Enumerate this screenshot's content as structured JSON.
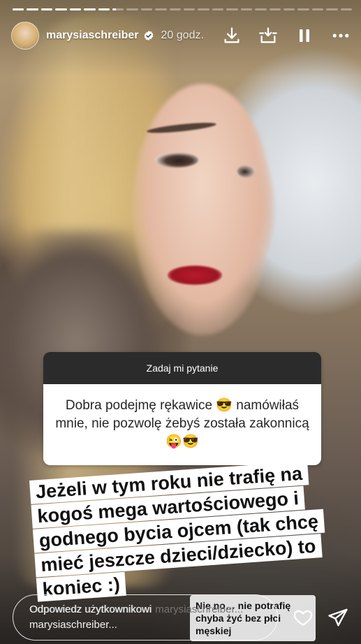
{
  "story": {
    "progress": {
      "segments": [
        1,
        1,
        1,
        1,
        1,
        1,
        1,
        0.3,
        0,
        0,
        0,
        0,
        0,
        0,
        0,
        0,
        0,
        0,
        0,
        0,
        0,
        0,
        0,
        0
      ]
    },
    "header": {
      "username": "marysiaschreiber",
      "time": "20 godz.",
      "icons": [
        "download-icon",
        "save-icon",
        "pause-icon",
        "more-icon"
      ]
    },
    "question_sticker": {
      "title": "Zadaj mi pytanie",
      "question": "Dobra podejmę rękawice 😎 namówiłaś mnie, nie pozwolę żebyś została zakonnicą 😜😎"
    },
    "answer_lines": [
      "Jeżeli w tym roku nie trafię na",
      "kogoś mega wartościowego i",
      "godnego bycia ojcem (tak chcę",
      "mieć jeszcze dzieci/dziecko) to",
      "koniec :)"
    ],
    "mini_sticker": "Nie no… nie potrafię chyba żyć bez płci męskiej",
    "reply": {
      "placeholder": "Odpowiedz użytkownikowi marysiaschreiber..."
    },
    "colors": {
      "accent": "#ffffff",
      "sticker_header": "#2b2b2b"
    }
  }
}
